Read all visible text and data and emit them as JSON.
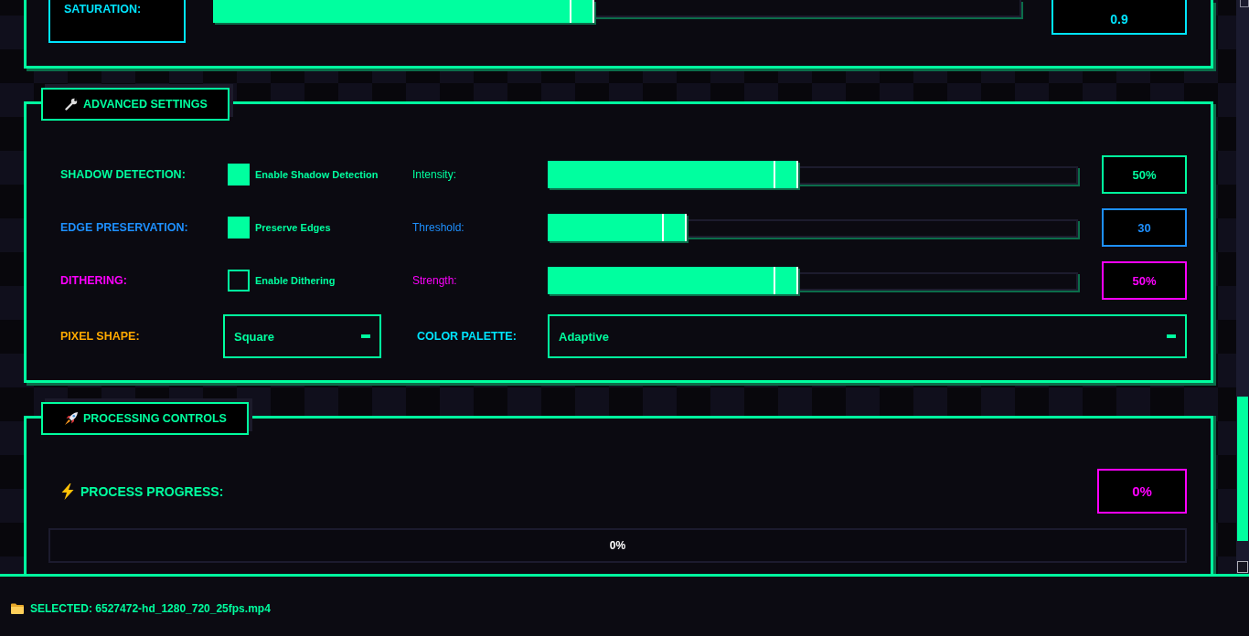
{
  "top_panel": {
    "rows": [
      {
        "label": "SATURATION:",
        "color": "#00e5ff",
        "level": 0.47,
        "value": "0.9"
      }
    ]
  },
  "advanced_settings": {
    "title": "ADVANCED SETTINGS",
    "rows": [
      {
        "kind": "toggle",
        "label": "SHADOW DETECTION:",
        "color": "#00ff9f",
        "checkbox": {
          "label": "Enable Shadow Detection",
          "checked": true
        },
        "slider": {
          "label": "Intensity:",
          "level": 0.47,
          "value": "50%"
        }
      },
      {
        "kind": "toggle",
        "label": "EDGE PRESERVATION:",
        "color": "#1e90ff",
        "checkbox": {
          "label": "Preserve Edges",
          "checked": true
        },
        "slider": {
          "label": "Threshold:",
          "level": 0.26,
          "value": "30"
        }
      },
      {
        "kind": "toggle",
        "label": "DITHERING:",
        "color": "#ff00ff",
        "checkbox": {
          "label": "Enable Dithering",
          "checked": false
        },
        "slider": {
          "label": "Strength:",
          "level": 0.47,
          "value": "50%"
        }
      },
      {
        "kind": "selects",
        "fields": [
          {
            "label": "PIXEL SHAPE:",
            "color": "#ffaa00",
            "value": "Square"
          },
          {
            "label": "COLOR PALETTE:",
            "color": "#00e5ff",
            "value": "Adaptive"
          }
        ]
      }
    ]
  },
  "processing_controls": {
    "title": "PROCESSING CONTROLS",
    "progress_label": "PROCESS PROGRESS:",
    "progress_value": "0%",
    "progress_bar": {
      "text": "0%"
    }
  },
  "status_bar": {
    "text": "SELECTED: 6527472-hd_1280_720_25fps.mp4"
  }
}
